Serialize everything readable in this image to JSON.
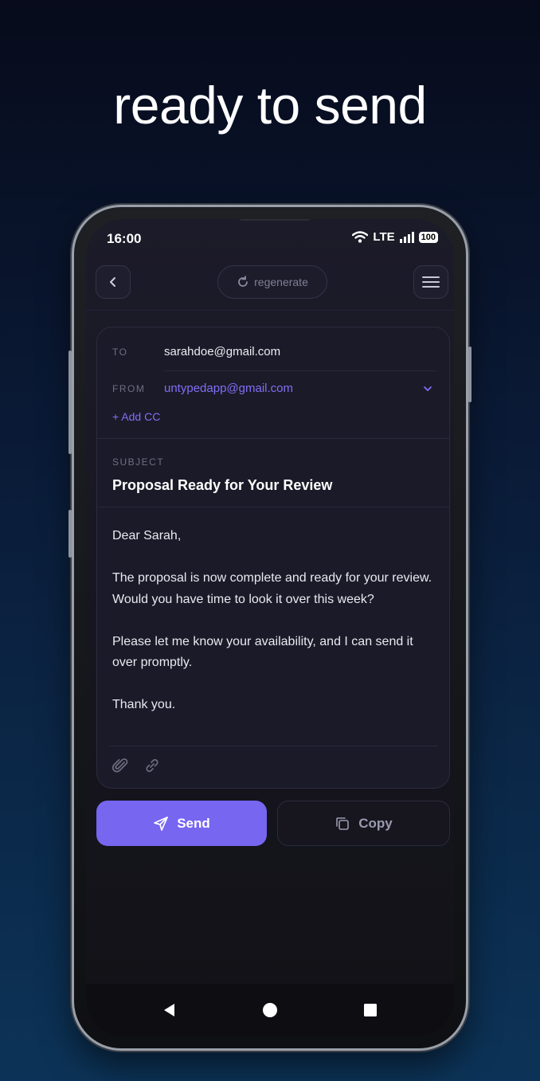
{
  "headline": "ready to send",
  "status_bar": {
    "time": "16:00",
    "network": "LTE",
    "battery": "100"
  },
  "toolbar": {
    "regenerate_label": "regenerate"
  },
  "email": {
    "to_label": "TO",
    "to_value": "sarahdoe@gmail.com",
    "from_label": "FROM",
    "from_value": "untypedapp@gmail.com",
    "add_cc": "+ Add CC",
    "subject_label": "SUBJECT",
    "subject": "Proposal Ready for Your Review",
    "body": [
      "Dear Sarah,",
      "The proposal is now complete and ready for your review. Would you have time to look it over this week?",
      "Please let me know your availability, and I can send it over promptly.",
      "Thank you."
    ]
  },
  "actions": {
    "send_label": "Send",
    "copy_label": "Copy"
  },
  "colors": {
    "accent": "#7666f0",
    "link": "#7e70f5",
    "background_top": "#070b1b",
    "background_bottom": "#0c3357"
  }
}
